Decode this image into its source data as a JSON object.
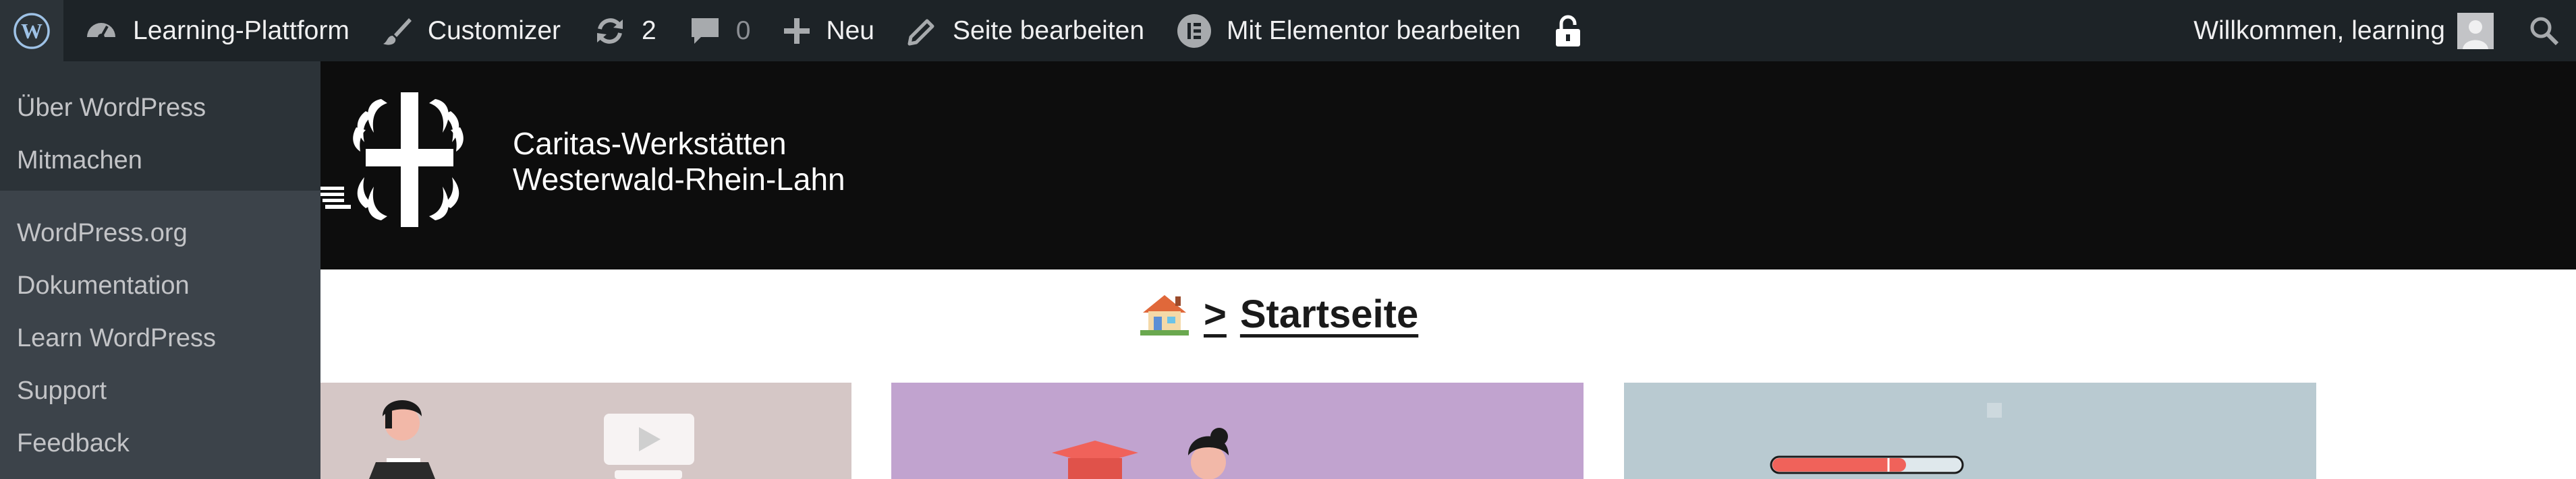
{
  "adminbar": {
    "site_name": "Learning-Plattform",
    "customizer": "Customizer",
    "updates_count": "2",
    "comments_count": "0",
    "new_label": "Neu",
    "edit_page": "Seite bearbeiten",
    "elementor_edit": "Mit Elementor bearbeiten",
    "greeting": "Willkommen, learning"
  },
  "wp_menu": {
    "group1": [
      "Über WordPress",
      "Mitmachen"
    ],
    "group2": [
      "WordPress.org",
      "Dokumentation",
      "Learn WordPress",
      "Support",
      "Feedback"
    ]
  },
  "header": {
    "org_line1": "Caritas-Werkstätten",
    "org_line2": "Westerwald-Rhein-Lahn"
  },
  "breadcrumb": {
    "separator": ">",
    "current": "Startseite"
  },
  "colors": {
    "adminbar_bg": "#1d2327",
    "dropdown_bg": "#2c3338",
    "header_bg": "#0d0d0d",
    "card1": "#d5c7c6",
    "card2": "#c1a3cf",
    "card3": "#b9cad1",
    "accent_red": "#f0625a"
  },
  "icons": [
    "wordpress-icon",
    "dashboard-icon",
    "brush-icon",
    "updates-icon",
    "comment-icon",
    "plus-icon",
    "pencil-icon",
    "elementor-icon",
    "unlock-icon",
    "avatar",
    "search-icon",
    "home-icon"
  ]
}
